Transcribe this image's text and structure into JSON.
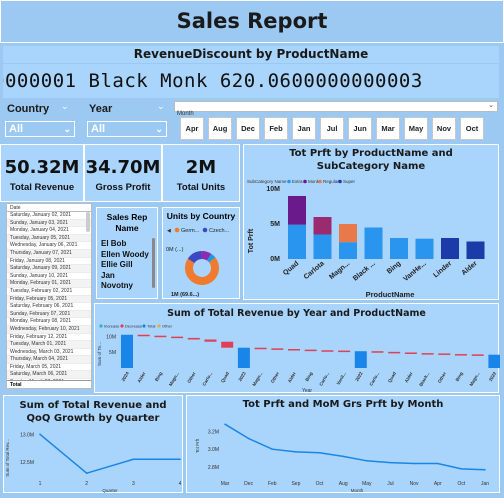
{
  "report": {
    "title": "Sales Report"
  },
  "revenue_discount": {
    "title": "RevenueDiscount by ProductName",
    "ticker": "0000001 Black Monk 620.0600000000003"
  },
  "filters": {
    "country": {
      "label": "Country",
      "value": "All"
    },
    "year": {
      "label": "Year",
      "value": "All"
    },
    "month": {
      "label": "Month",
      "options": [
        "Apr",
        "Aug",
        "Dec",
        "Feb",
        "Jan",
        "Jul",
        "Jun",
        "Mar",
        "May",
        "Nov",
        "Oct"
      ]
    }
  },
  "kpis": {
    "total_revenue": {
      "value": "50.32M",
      "label": "Total Revenue"
    },
    "gross_profit": {
      "value": "34.70M",
      "label": "Gross Profit"
    },
    "total_units": {
      "value": "2M",
      "label": "Total Units"
    }
  },
  "date_table": {
    "header": "Date",
    "rows": [
      "Saturday, January 02, 2021",
      "Sunday, January 03, 2021",
      "Monday, January 04, 2021",
      "Tuesday, January 05, 2021",
      "Wednesday, January 06, 2021",
      "Thursday, January 07, 2021",
      "Friday, January 08, 2021",
      "Saturday, January 09, 2021",
      "Sunday, January 10, 2021",
      "Monday, February 01, 2021",
      "Tuesday, February 02, 2021",
      "Friday, February 05, 2021",
      "Saturday, February 06, 2021",
      "Sunday, February 07, 2021",
      "Monday, February 08, 2021",
      "Wednesday, February 10, 2021",
      "Friday, February 12, 2021",
      "Tuesday, March 01, 2021",
      "Wednesday, March 03, 2021",
      "Thursday, March 04, 2021",
      "Friday, March 05, 2021",
      "Saturday, March 06, 2021",
      "Sunday, March 07, 2021"
    ],
    "total": "Total"
  },
  "sales_rep": {
    "title": "Sales Rep Name",
    "names": [
      "El Bob",
      "Ellen Woody",
      "Ellie Gill",
      "Jan",
      "Novotny"
    ]
  },
  "units_by_country": {
    "title": "Units by Country",
    "legend": [
      "Germ...",
      "Czech..."
    ],
    "labels": {
      "top": "0M (...)",
      "bottom": "1M (69.6...)"
    },
    "colors": [
      "#f07a2e",
      "#3b48c4",
      "#8f2bb0",
      "#1a9be0"
    ]
  },
  "colors": {
    "blue": "#2a95ef",
    "purple": "#6b1a8c",
    "magenta": "#9c2a6e",
    "orange": "#e8794a",
    "navy": "#1c3aa8",
    "increase": "#30b3b5",
    "decrease": "#e04055",
    "total": "#1a85e8",
    "other": "#d6b24a"
  },
  "chart_data": [
    {
      "type": "bar",
      "title": "Tot Prft by ProductName and SubCategory Name",
      "legend_title": "SubCategory Name",
      "legend": [
        "Extra",
        "Monk",
        "Regular",
        "Super"
      ],
      "xlabel": "ProductName",
      "ylabel": "Tot Prft",
      "ylim": [
        0,
        10
      ],
      "yticks": [
        "0M",
        "5M",
        "10M"
      ],
      "categories": [
        "Quad",
        "Carlota",
        "Magn...",
        "Black ...",
        "Bing",
        "VanHe...",
        "Linder",
        "Alder"
      ],
      "segments": [
        [
          {
            "c": "blue",
            "v": 4.9
          },
          {
            "c": "purple",
            "v": 4.1
          }
        ],
        [
          {
            "c": "blue",
            "v": 3.5
          },
          {
            "c": "magenta",
            "v": 2.5
          }
        ],
        [
          {
            "c": "blue",
            "v": 2.4
          },
          {
            "c": "orange",
            "v": 2.6
          }
        ],
        [
          {
            "c": "blue",
            "v": 4.5
          }
        ],
        [
          {
            "c": "blue",
            "v": 3.0
          }
        ],
        [
          {
            "c": "blue",
            "v": 2.9
          }
        ],
        [
          {
            "c": "navy",
            "v": 3.0
          }
        ],
        [
          {
            "c": "navy",
            "v": 2.5
          }
        ]
      ]
    },
    {
      "type": "bar",
      "subtype": "waterfall",
      "title": "Sum of Total Revenue by Year and ProductName",
      "legend": [
        "Increase",
        "Decrease",
        "Total",
        "Other"
      ],
      "xlabel": "Year",
      "ylabel": "Sum of To...",
      "yticks": [
        "5M",
        "10M"
      ],
      "ylim": [
        0,
        12
      ],
      "categories": [
        "2024",
        "Alder",
        "Bing",
        "Magn...",
        "Other",
        "Carlo...",
        "Quad",
        "2023",
        "Magn...",
        "Other",
        "Alder",
        "Bing",
        "Carlo...",
        "Vanil...",
        "2022",
        "Carlo...",
        "Quad",
        "Alder",
        "Black...",
        "Other",
        "Bing",
        "Magn...",
        "2022"
      ],
      "bars": [
        {
          "k": "total",
          "y0": 0,
          "y1": 10.5
        },
        {
          "k": "decrease",
          "y0": 10.5,
          "y1": 10.2
        },
        {
          "k": "decrease",
          "y0": 10.2,
          "y1": 9.9
        },
        {
          "k": "decrease",
          "y0": 9.9,
          "y1": 9.5
        },
        {
          "k": "decrease",
          "y0": 9.5,
          "y1": 9.0
        },
        {
          "k": "decrease",
          "y0": 9.0,
          "y1": 8.3
        },
        {
          "k": "decrease",
          "y0": 8.3,
          "y1": 6.4
        },
        {
          "k": "total",
          "y0": 0,
          "y1": 6.4
        },
        {
          "k": "decrease",
          "y0": 6.4,
          "y1": 6.2
        },
        {
          "k": "decrease",
          "y0": 6.2,
          "y1": 6.0
        },
        {
          "k": "decrease",
          "y0": 6.0,
          "y1": 5.8
        },
        {
          "k": "decrease",
          "y0": 5.8,
          "y1": 5.6
        },
        {
          "k": "decrease",
          "y0": 5.6,
          "y1": 5.5
        },
        {
          "k": "decrease",
          "y0": 5.5,
          "y1": 5.3
        },
        {
          "k": "total",
          "y0": 0,
          "y1": 5.3
        },
        {
          "k": "decrease",
          "y0": 5.3,
          "y1": 5.1
        },
        {
          "k": "decrease",
          "y0": 5.1,
          "y1": 4.9
        },
        {
          "k": "decrease",
          "y0": 4.9,
          "y1": 4.7
        },
        {
          "k": "decrease",
          "y0": 4.7,
          "y1": 4.6
        },
        {
          "k": "decrease",
          "y0": 4.6,
          "y1": 4.4
        },
        {
          "k": "decrease",
          "y0": 4.4,
          "y1": 4.3
        },
        {
          "k": "decrease",
          "y0": 4.3,
          "y1": 4.2
        },
        {
          "k": "total",
          "y0": 0,
          "y1": 4.2
        }
      ]
    },
    {
      "type": "line",
      "title": "Sum of Total Revenue and QoQ Growth by Quarter",
      "xlabel": "Quarter",
      "ylabel": "Sum of Total Rev...",
      "ylim": [
        12.25,
        13.15
      ],
      "yticks": [
        {
          "v": 12.5,
          "t": "12.5M"
        },
        {
          "v": 13.0,
          "t": "13.0M"
        }
      ],
      "x": [
        "1",
        "2",
        "3",
        "4"
      ],
      "values": [
        13.0,
        12.3,
        12.55,
        12.55
      ]
    },
    {
      "type": "line",
      "title": "Tot Prft and MoM Grs Prft by Month",
      "xlabel": "Month",
      "ylabel": "Tot Prft",
      "ylim": [
        2.7,
        3.35
      ],
      "yticks": [
        {
          "v": 2.8,
          "t": "2.8M"
        },
        {
          "v": 3.0,
          "t": "3.0M"
        },
        {
          "v": 3.2,
          "t": "3.2M"
        }
      ],
      "x": [
        "Mar",
        "Dec",
        "Feb",
        "Sep",
        "Oct",
        "Aug",
        "May",
        "Jul",
        "Nov",
        "Apr",
        "Oct",
        "Jan"
      ],
      "values": [
        3.28,
        3.12,
        3.0,
        2.97,
        2.96,
        2.92,
        2.87,
        2.85,
        2.84,
        2.84,
        2.78,
        2.77
      ]
    }
  ]
}
